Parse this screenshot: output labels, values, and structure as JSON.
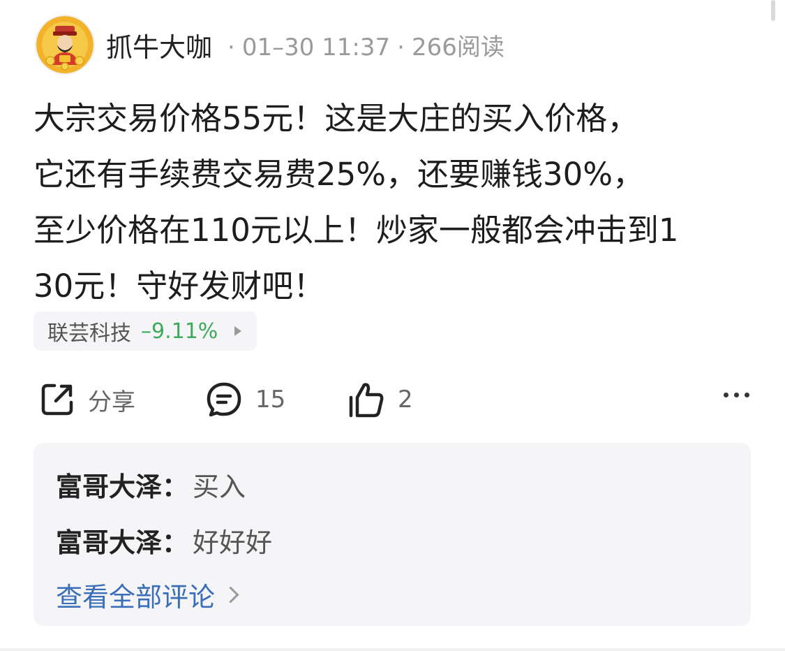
{
  "post": {
    "author": "抓牛大咖",
    "separator": "·",
    "time": "01–30 11:37",
    "reads": "266阅读",
    "text_lines": [
      "大宗交易价格55元！这是大庄的买入价格，",
      "它还有手续费交易费25%，还要赚钱30%，",
      "至少价格在110元以上！炒家一般都会冲击到1",
      "30元！守好发财吧！"
    ]
  },
  "stock": {
    "name": "联芸科技",
    "change": "–9.11%",
    "change_color": "#3eaa5d"
  },
  "actions": {
    "share_label": "分享",
    "comment_count": "15",
    "like_count": "2"
  },
  "comments": {
    "items": [
      {
        "name": "富哥大泽",
        "sep": "：",
        "text": "买入"
      },
      {
        "name": "富哥大泽",
        "sep": "：",
        "text": "好好好"
      }
    ],
    "view_all_label": "查看全部评论"
  },
  "colors": {
    "link": "#3a6fb7",
    "secondary_text": "#9a9a9a",
    "panel_bg": "#f5f5f7"
  }
}
